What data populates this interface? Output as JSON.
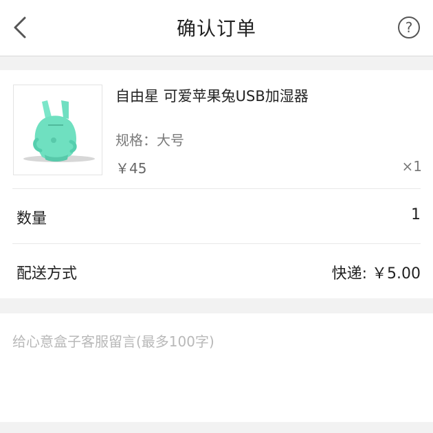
{
  "header": {
    "title": "确认订单",
    "back_icon": "chevron-left-icon",
    "help_icon": "question-circle-icon"
  },
  "product": {
    "name": "自由星 可爱苹果兔USB加湿器",
    "spec": "规格：大号",
    "price": "￥45",
    "quantity_mark": "×1",
    "image": "mint-green-rabbit-humidifier",
    "image_color": "#6fe0c0"
  },
  "quantity_row": {
    "label": "数量",
    "value": "1"
  },
  "delivery_row": {
    "label": "配送方式",
    "value": "快递: ￥5.00"
  },
  "message": {
    "placeholder": "给心意盒子客服留言(最多100字)",
    "value": ""
  }
}
